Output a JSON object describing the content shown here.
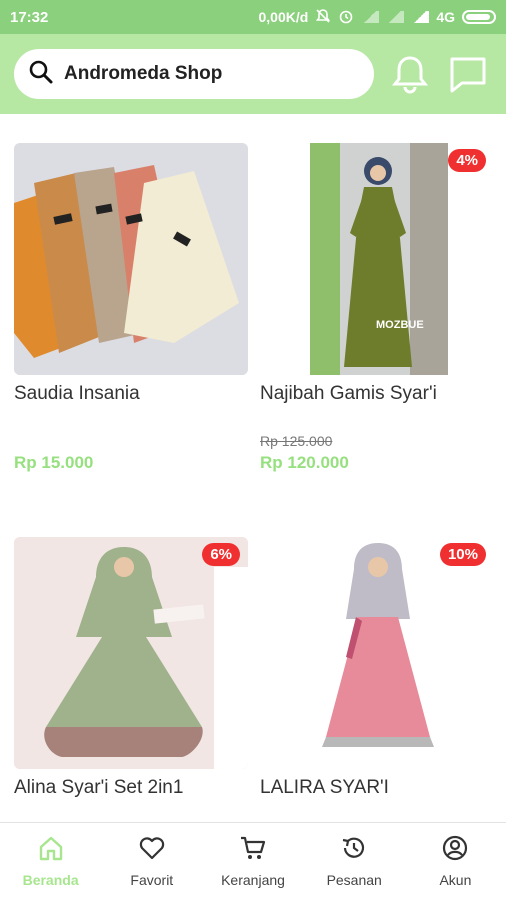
{
  "status_bar": {
    "time": "17:32",
    "speed": "0,00K/d",
    "network": "4G"
  },
  "search": {
    "text": "Andromeda Shop"
  },
  "products": [
    {
      "title": "Saudia Insania",
      "old_price": "",
      "price": "Rp 15.000",
      "discount": ""
    },
    {
      "title": "Najibah Gamis Syar'i",
      "old_price": "Rp 125.000",
      "price": "Rp 120.000",
      "discount": "4%",
      "brand_mark": "MOZBUE"
    },
    {
      "title": "Alina Syar'i Set 2in1",
      "old_price": "",
      "price": "",
      "discount": "6%"
    },
    {
      "title": "LALIRA SYAR'I",
      "old_price": "",
      "price": "",
      "discount": "10%"
    }
  ],
  "nav": [
    {
      "label": "Beranda",
      "icon": "home-icon",
      "active": true
    },
    {
      "label": "Favorit",
      "icon": "heart-icon"
    },
    {
      "label": "Keranjang",
      "icon": "cart-icon"
    },
    {
      "label": "Pesanan",
      "icon": "history-icon"
    },
    {
      "label": "Akun",
      "icon": "account-icon"
    }
  ],
  "colors": {
    "status_bar": "#8bd07c",
    "header": "#b6e8a3",
    "price": "#96e07f",
    "badge": "#f03030",
    "active_nav": "#a7e68f"
  }
}
